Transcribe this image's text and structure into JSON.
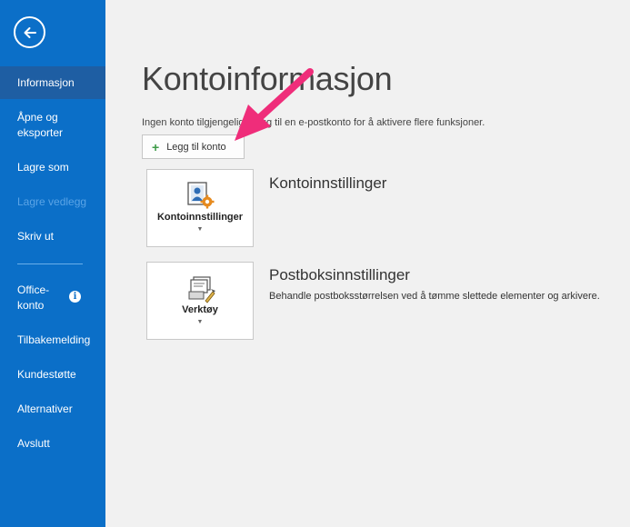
{
  "sidebar": {
    "back_icon": "back-arrow-icon",
    "items": [
      {
        "label": "Informasjon",
        "state": "active"
      },
      {
        "label": "Åpne og eksporter",
        "state": "normal"
      },
      {
        "label": "Lagre som",
        "state": "normal"
      },
      {
        "label": "Lagre vedlegg",
        "state": "disabled"
      },
      {
        "label": "Skriv ut",
        "state": "normal"
      },
      {
        "label": "Office-konto",
        "state": "normal",
        "badge_icon": "info-icon"
      },
      {
        "label": "Tilbakemelding",
        "state": "normal"
      },
      {
        "label": "Kundestøtte",
        "state": "normal"
      },
      {
        "label": "Alternativer",
        "state": "normal"
      },
      {
        "label": "Avslutt",
        "state": "normal"
      }
    ],
    "info_glyph": "i"
  },
  "main": {
    "title": "Kontoinformasjon",
    "subtitle": "Ingen konto tilgjengelig. Legg til en e-postkonto for å aktivere flere funksjoner.",
    "add_account": {
      "label": "Legg til konto",
      "plus": "+"
    },
    "sections": [
      {
        "tile_label": "Kontoinnstillinger",
        "icon": "account-settings-icon",
        "title": "Kontoinnstillinger",
        "description": ""
      },
      {
        "tile_label": "Verktøy",
        "icon": "tools-icon",
        "title": "Postboksinnstillinger",
        "description": "Behandle postboksstørrelsen ved å tømme slettede elementer og arkivere."
      }
    ]
  },
  "annotation": {
    "icon": "pink-arrow-icon",
    "color": "#ef2d7a"
  },
  "colors": {
    "sidebar": "#0b6fc8",
    "sidebar_active": "#1e5ea3",
    "background": "#f1f1f1"
  }
}
